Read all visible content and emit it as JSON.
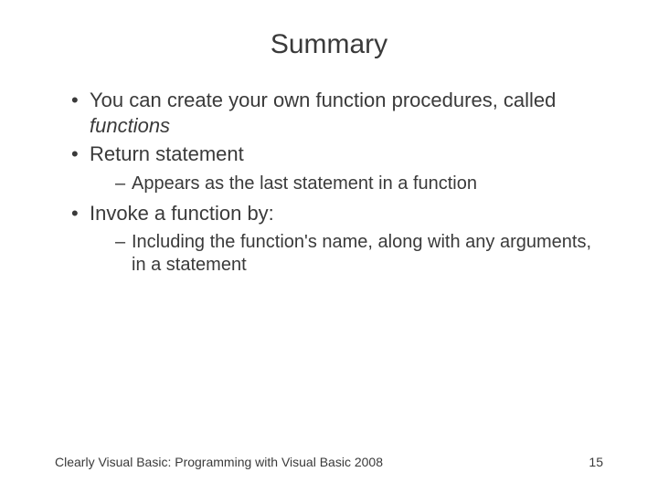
{
  "title": "Summary",
  "bullets": {
    "b1_pre": "You can create your own function procedures, called ",
    "b1_em": "functions",
    "b2": "Return statement",
    "b2_sub1": "Appears as the last statement in a function",
    "b3": "Invoke a function by:",
    "b3_sub1": "Including the function's name, along with any arguments, in a statement"
  },
  "footer": {
    "source": "Clearly Visual Basic: Programming with Visual Basic 2008",
    "page": "15"
  }
}
